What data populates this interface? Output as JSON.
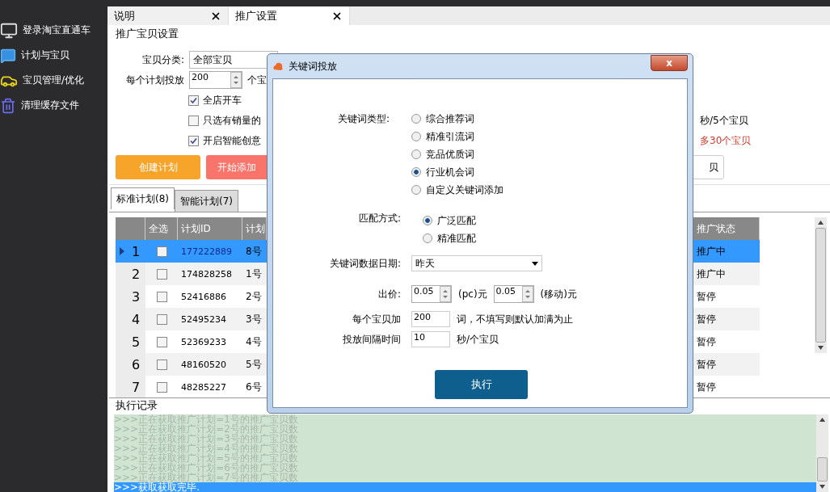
{
  "sidebar": {
    "items": [
      {
        "label": "登录淘宝直通车",
        "kind": "monitor"
      },
      {
        "label": "计划与宝贝",
        "kind": "chat"
      },
      {
        "label": "宝贝管理/优化",
        "kind": "car"
      },
      {
        "label": "清理缓存文件",
        "kind": "trash"
      }
    ]
  },
  "tabs": [
    {
      "label": "说明",
      "selected": false
    },
    {
      "label": "推广设置",
      "selected": true
    }
  ],
  "settings": {
    "title": "推广宝贝设置",
    "category_label": "宝贝分类:",
    "category_value": "全部宝贝",
    "per_plan_label": "每个计划投放",
    "per_plan_value": "200",
    "per_plan_unit": "个宝",
    "checkboxes": [
      {
        "label": "全店开车",
        "checked": true
      },
      {
        "label": "只选有销量的",
        "checked": false
      },
      {
        "label": "开启智能创意",
        "checked": true
      }
    ],
    "notes": [
      {
        "text": "秒/5个宝贝",
        "kind": "normal"
      },
      {
        "text": "多30个宝贝",
        "kind": "warning"
      }
    ],
    "buttons": [
      {
        "label": "创建计划",
        "color": "#f7a42b"
      },
      {
        "label": "开始添加",
        "color": "#f9756b"
      },
      {
        "label": "贝",
        "color": "#ffffff"
      }
    ]
  },
  "plan_tabs": [
    {
      "label": "标准计划(8)",
      "selected": true
    },
    {
      "label": "智能计划(7)",
      "selected": false
    }
  ],
  "table": {
    "columns": [
      "全选",
      "计划ID",
      "计划",
      "推广状态"
    ],
    "rows": [
      {
        "index": "1",
        "checked": false,
        "selected": true,
        "id": "177222889",
        "name": "8号",
        "status": "推广中"
      },
      {
        "index": "2",
        "checked": false,
        "selected": false,
        "id": "174828258",
        "name": "1号",
        "status": "推广中"
      },
      {
        "index": "3",
        "checked": false,
        "selected": false,
        "id": "52416886",
        "name": "2号",
        "status": "暂停"
      },
      {
        "index": "4",
        "checked": false,
        "selected": false,
        "id": "52495234",
        "name": "3号",
        "status": "暂停"
      },
      {
        "index": "5",
        "checked": false,
        "selected": false,
        "id": "52369233",
        "name": "4号",
        "status": "暂停"
      },
      {
        "index": "6",
        "checked": false,
        "selected": false,
        "id": "48160520",
        "name": "5号",
        "status": "暂停"
      },
      {
        "index": "7",
        "checked": false,
        "selected": false,
        "id": "48285227",
        "name": "6号",
        "status": "暂停"
      }
    ]
  },
  "log": {
    "title": "执行记录",
    "lines": [
      {
        "text": ">>>正在获取推广计划=1号的推广宝贝数",
        "selected": false
      },
      {
        "text": ">>>正在获取推广计划=2号的推广宝贝数",
        "selected": false
      },
      {
        "text": ">>>正在获取推广计划=3号的推广宝贝数",
        "selected": false
      },
      {
        "text": ">>>正在获取推广计划=4号的推广宝贝数",
        "selected": false
      },
      {
        "text": ">>>正在获取推广计划=5号的推广宝贝数",
        "selected": false
      },
      {
        "text": ">>>正在获取推广计划=6号的推广宝贝数",
        "selected": false
      },
      {
        "text": ">>>正在获取推广计划=7号的推广宝贝数",
        "selected": false
      },
      {
        "text": ">>>获取获取完毕.",
        "selected": true
      }
    ]
  },
  "dialog": {
    "title": "关键词投放",
    "close": "x",
    "keyword_type_label": "关键词类型:",
    "keyword_types": [
      {
        "label": "综合推荐词",
        "selected": false
      },
      {
        "label": "精准引流词",
        "selected": false
      },
      {
        "label": "竞品优质词",
        "selected": false
      },
      {
        "label": "行业机会词",
        "selected": true
      },
      {
        "label": "自定义关键词添加",
        "selected": false
      }
    ],
    "match_label": "匹配方式:",
    "match_modes": [
      {
        "label": "广泛匹配",
        "selected": true
      },
      {
        "label": "精准匹配",
        "selected": false
      }
    ],
    "date_label": "关键词数据日期:",
    "date_value": "昨天",
    "price_label": "出价:",
    "price_pc": "0.05",
    "price_pc_unit": "(pc)元",
    "price_mobile": "0.05",
    "price_mobile_unit": "(移动)元",
    "per_item_label": "每个宝贝加",
    "per_item_value": "200",
    "per_item_hint": "词，不填写则默认加满为止",
    "interval_label": "投放间隔时间",
    "interval_value": "10",
    "interval_unit": "秒/个宝贝",
    "execute": "执行"
  }
}
